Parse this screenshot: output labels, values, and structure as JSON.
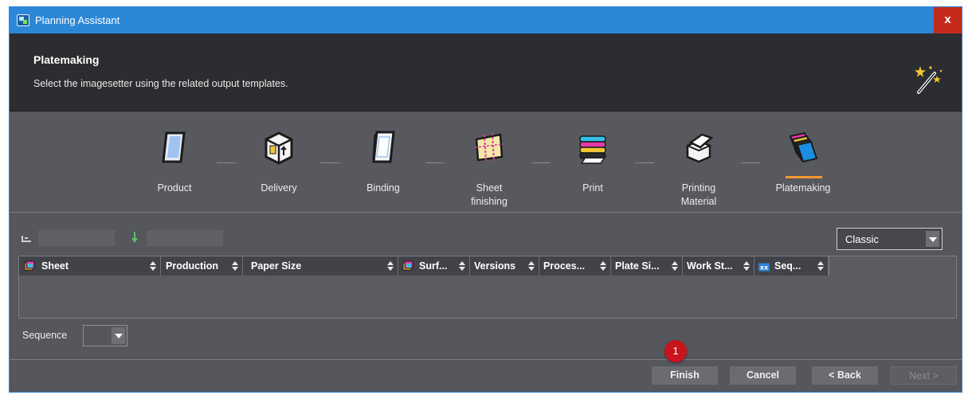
{
  "window": {
    "title": "Planning Assistant",
    "close_label": "x"
  },
  "header": {
    "title": "Platemaking",
    "subtitle": "Select the imagesetter using the related output templates."
  },
  "steps": [
    {
      "label": "Product"
    },
    {
      "label": "Delivery"
    },
    {
      "label": "Binding"
    },
    {
      "label": "Sheet finishing"
    },
    {
      "label": "Print"
    },
    {
      "label": "Printing Material"
    },
    {
      "label": "Platemaking",
      "active": true
    }
  ],
  "view_select": {
    "value": "Classic"
  },
  "table": {
    "columns": [
      "Sheet",
      "Production",
      "Paper Size",
      "Surf...",
      "Versions",
      "Proces...",
      "Plate Si...",
      "Work St...",
      "Seq..."
    ]
  },
  "sequence": {
    "label": "Sequence",
    "value": ""
  },
  "buttons": {
    "finish": "Finish",
    "cancel": "Cancel",
    "back": "< Back",
    "next": "Next >"
  },
  "badge": {
    "number": "1"
  },
  "colors": {
    "titlebar": "#2b88d8",
    "close": "#c42b1c",
    "active_step_underline": "#f29a2e",
    "badge": "#c8141c"
  }
}
